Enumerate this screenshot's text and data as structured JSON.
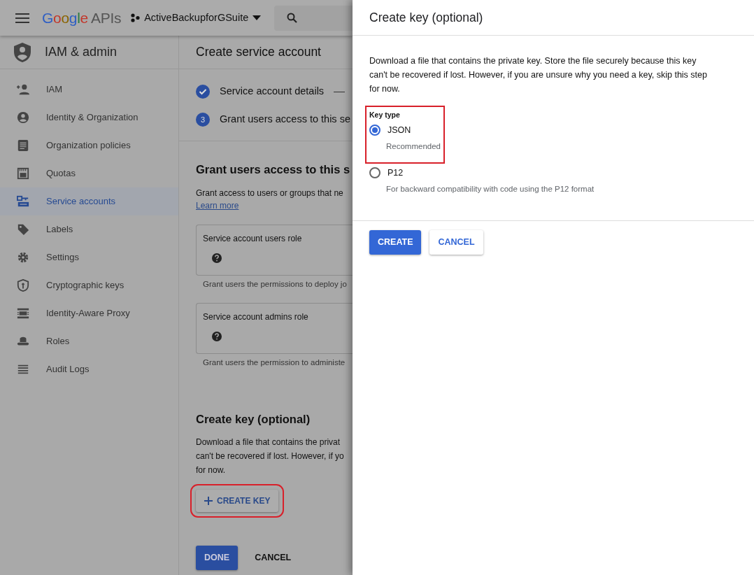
{
  "header": {
    "logo_brand": "Google",
    "logo_product": "APIs",
    "project": "ActiveBackupforGSuite"
  },
  "sidebar": {
    "title": "IAM & admin",
    "items": [
      {
        "label": "IAM",
        "selected": false
      },
      {
        "label": "Identity & Organization",
        "selected": false
      },
      {
        "label": "Organization policies",
        "selected": false
      },
      {
        "label": "Quotas",
        "selected": false
      },
      {
        "label": "Service accounts",
        "selected": true
      },
      {
        "label": "Labels",
        "selected": false
      },
      {
        "label": "Settings",
        "selected": false
      },
      {
        "label": "Cryptographic keys",
        "selected": false
      },
      {
        "label": "Identity-Aware Proxy",
        "selected": false
      },
      {
        "label": "Roles",
        "selected": false
      },
      {
        "label": "Audit Logs",
        "selected": false
      }
    ]
  },
  "page": {
    "title": "Create service account",
    "steps": [
      {
        "kind": "done",
        "label": "Service account details"
      },
      {
        "kind": "number",
        "number": "3",
        "label": "Grant users access to this se"
      }
    ],
    "grant": {
      "heading": "Grant users access to this s",
      "text": "Grant access to users or groups that ne",
      "link": "Learn more",
      "fields": [
        {
          "label": "Service account users role",
          "help": "Grant users the permissions to deploy jo"
        },
        {
          "label": "Service account admins role",
          "help": "Grant users the permission to administe"
        }
      ]
    },
    "key": {
      "heading": "Create key (optional)",
      "lines": [
        "Download a file that contains the privat",
        "can't be recovered if lost. However, if yo",
        "for now."
      ],
      "button": {
        "label": "CREATE KEY",
        "highlighted": true
      }
    },
    "actions": [
      {
        "label": "DONE",
        "kind": "primary"
      },
      {
        "label": "CANCEL",
        "kind": "text"
      }
    ]
  },
  "dialog": {
    "title": "Create key (optional)",
    "text": "Download a file that contains the private key. Store the file securely because this key can't be recovered if lost. However, if you are unsure why you need a key, skip this step for now.",
    "key_type": {
      "label": "Key type",
      "highlighted": true,
      "options": [
        {
          "label": "JSON",
          "hint": "Recommended",
          "selected": true
        },
        {
          "label": "P12",
          "hint": "For backward compatibility with code using the P12 format",
          "selected": false
        }
      ]
    },
    "buttons": [
      {
        "label": "CREATE",
        "kind": "primary"
      },
      {
        "label": "CANCEL",
        "kind": "outline"
      }
    ]
  }
}
